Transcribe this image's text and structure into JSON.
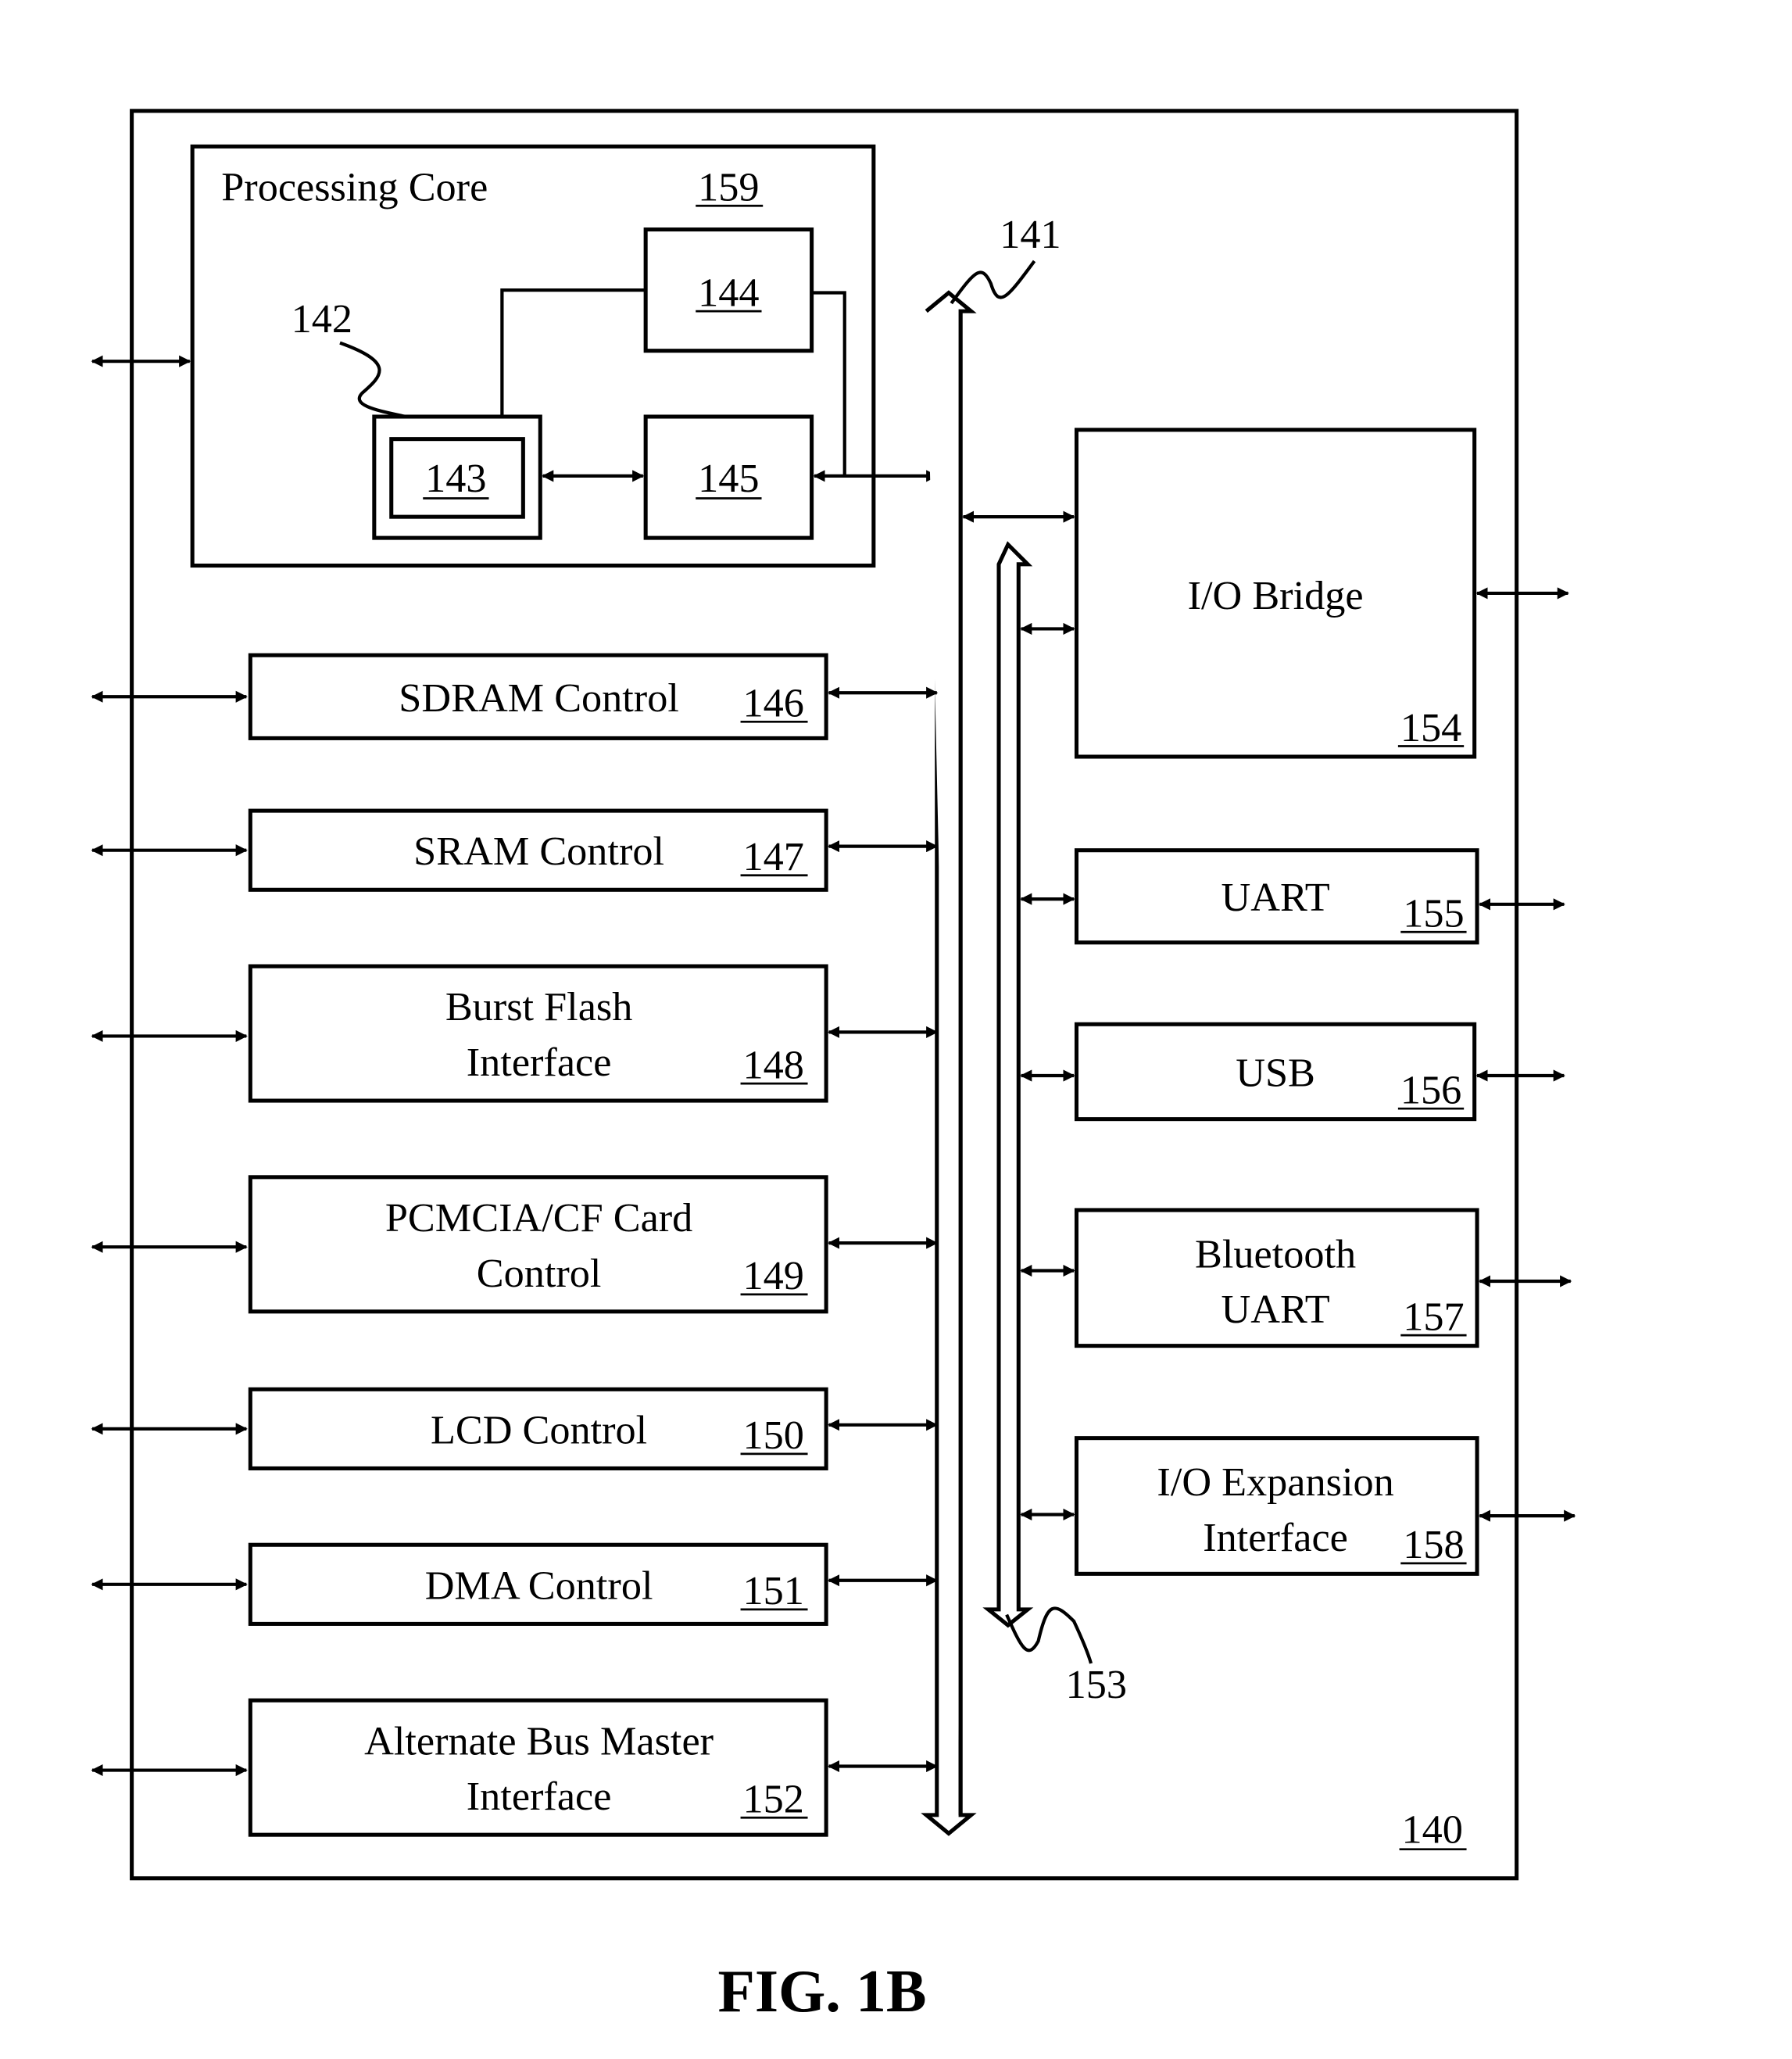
{
  "figure": {
    "caption": "FIG. 1B",
    "system_ref": "140",
    "processing_core": {
      "label": "Processing Core",
      "ref": "159"
    },
    "core_blocks": [
      {
        "ref": "143",
        "leader_ref": "142"
      },
      {
        "ref": "144"
      },
      {
        "ref": "145"
      }
    ],
    "bus_main_ref": "141",
    "bus_secondary_ref": "153",
    "left_blocks": [
      {
        "lines": [
          "SDRAM Control"
        ],
        "ref": "146"
      },
      {
        "lines": [
          "SRAM Control"
        ],
        "ref": "147"
      },
      {
        "lines": [
          "Burst Flash",
          "Interface"
        ],
        "ref": "148"
      },
      {
        "lines": [
          "PCMCIA/CF Card",
          "Control"
        ],
        "ref": "149"
      },
      {
        "lines": [
          "LCD Control"
        ],
        "ref": "150"
      },
      {
        "lines": [
          "DMA Control"
        ],
        "ref": "151"
      },
      {
        "lines": [
          "Alternate Bus Master",
          "Interface"
        ],
        "ref": "152"
      }
    ],
    "right_blocks": [
      {
        "lines": [
          "I/O Bridge"
        ],
        "ref": "154"
      },
      {
        "lines": [
          "UART"
        ],
        "ref": "155"
      },
      {
        "lines": [
          "USB"
        ],
        "ref": "156"
      },
      {
        "lines": [
          "Bluetooth",
          "UART"
        ],
        "ref": "157"
      },
      {
        "lines": [
          "I/O Expansion",
          "Interface"
        ],
        "ref": "158"
      }
    ]
  }
}
